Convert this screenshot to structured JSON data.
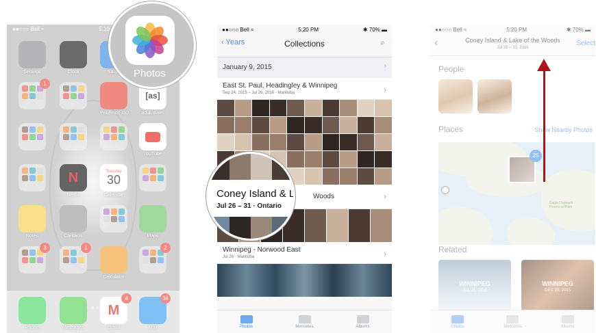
{
  "phone1": {
    "status": {
      "carrier": "●●○○○ Bell ≈",
      "time": "5:10 PM",
      "battery": ""
    },
    "apps": [
      {
        "label": "Settings",
        "icon": "settings-icon",
        "badge": ""
      },
      {
        "label": "Clock",
        "icon": "clock-icon",
        "badge": ""
      },
      {
        "label": "Safari",
        "icon": "safari-icon",
        "badge": ""
      },
      {
        "label": "",
        "icon": "folder-icon",
        "badge": "3"
      },
      {
        "label": "",
        "icon": "folder-icon",
        "badge": "1"
      },
      {
        "label": "",
        "icon": "folder-icon",
        "badge": ""
      },
      {
        "label": "Pokémon GO",
        "icon": "pokeball-icon",
        "badge": ""
      },
      {
        "label": "adult swim",
        "icon": "adult-swim-icon",
        "text": "[as]",
        "badge": ""
      },
      {
        "label": "",
        "icon": "folder-icon",
        "badge": ""
      },
      {
        "label": "",
        "icon": "folder-icon",
        "badge": ""
      },
      {
        "label": "",
        "icon": "folder-icon",
        "badge": ""
      },
      {
        "label": "YouTube",
        "icon": "youtube-icon",
        "badge": ""
      },
      {
        "label": "",
        "icon": "folder-icon",
        "badge": ""
      },
      {
        "label": "Netflix",
        "icon": "netflix-icon",
        "text": "N",
        "badge": ""
      },
      {
        "label": "Calendar",
        "icon": "calendar-icon",
        "day": "Tuesday",
        "date": "30",
        "badge": ""
      },
      {
        "label": "",
        "icon": "folder-icon",
        "badge": ""
      },
      {
        "label": "Notes",
        "icon": "notes-icon",
        "badge": ""
      },
      {
        "label": "Contacts",
        "icon": "contacts-icon",
        "badge": ""
      },
      {
        "label": "",
        "icon": "folder-icon",
        "badge": ""
      },
      {
        "label": "Maps",
        "icon": "maps-icon",
        "badge": ""
      },
      {
        "label": "",
        "icon": "folder-icon",
        "badge": "3"
      },
      {
        "label": "",
        "icon": "folder-icon",
        "badge": "1"
      },
      {
        "label": "Calculator",
        "icon": "calculator-icon",
        "badge": ""
      },
      {
        "label": "",
        "icon": "folder-icon",
        "badge": "2"
      }
    ],
    "dock": [
      {
        "label": "Phone",
        "icon": "phone-icon",
        "badge": ""
      },
      {
        "label": "Messages",
        "icon": "messages-icon",
        "badge": ""
      },
      {
        "label": "Gmail",
        "icon": "gmail-icon",
        "badge": "4"
      },
      {
        "label": "Mail",
        "icon": "mail-icon",
        "badge": "34"
      }
    ],
    "zoom_label": "Photos"
  },
  "phone2": {
    "status": {
      "carrier": "●●○○○ Bell ≈",
      "time": "5:20 PM",
      "battery": "✱ 70% ▬"
    },
    "nav": {
      "back": "Years",
      "title": "Collections",
      "search_icon": "search-icon"
    },
    "date_row": "January 9, 2015",
    "collections": [
      {
        "title": "East St. Paul, Headingley & Winnipeg",
        "subtitle": "Sep 24, 2015 – Jul 26, 2016 · Manitoba"
      },
      {
        "title": "Coney Island & Lake of the Woods",
        "subtitle": "Jul 26 – 31 · Ontario"
      },
      {
        "title": "Winnipeg - Norwood East",
        "subtitle": "Jul 26 · Manitoba"
      }
    ],
    "zoom": {
      "title": "Coney Island & La",
      "subtitle": "Jul 26 – 31 · Ontario",
      "tail": "Woods"
    },
    "tabs": [
      {
        "label": "Photos",
        "active": true
      },
      {
        "label": "Memories",
        "active": false
      },
      {
        "label": "Albums",
        "active": false
      }
    ]
  },
  "phone3": {
    "status": {
      "carrier": "●●○○○ Bell ≈",
      "time": "5:20 PM",
      "battery": "✱ 70% ▬"
    },
    "nav": {
      "title": "Coney Island & Lake of the Woods",
      "subtitle": "Jul 26 – 31, 2016",
      "action": "Select"
    },
    "people_label": "People",
    "places_label": "Places",
    "nearby_link": "Show Nearby Photos",
    "map_pin_count": "25",
    "map_label": "Eagle Dogtooth Provincial Park",
    "related_label": "Related",
    "related": [
      {
        "title": "WINNIPEG",
        "date": "JUL 26, 2016"
      },
      {
        "title": "WINNIPEG",
        "date": "DEC 28, 2015"
      }
    ],
    "tabs": [
      {
        "label": "Photos",
        "active": true
      },
      {
        "label": "Memories",
        "active": false
      },
      {
        "label": "Albums",
        "active": false
      }
    ]
  },
  "colors": {
    "accent": "#3b8ce8",
    "arrow": "#b0141a",
    "badge": "#ef4c43"
  }
}
